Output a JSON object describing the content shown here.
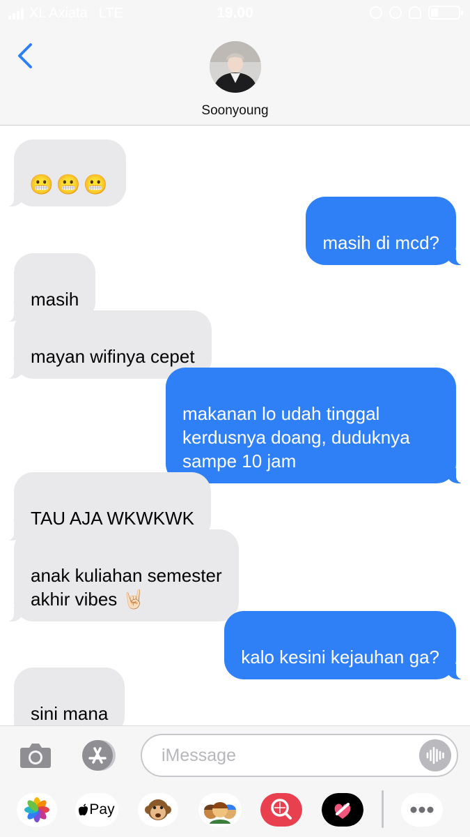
{
  "status_bar": {
    "carrier": "XL Axiata",
    "network": "LTE",
    "time": "19.00"
  },
  "header": {
    "contact_name": "Soonyoung"
  },
  "messages": [
    {
      "direction": "in",
      "text": "😬😬😬"
    },
    {
      "direction": "out",
      "text": "masih di mcd?"
    },
    {
      "direction": "in",
      "text": "masih"
    },
    {
      "direction": "in",
      "text": "mayan wifinya cepet"
    },
    {
      "direction": "out",
      "text": "makanan lo udah tinggal\nkerdusnya doang, duduknya\nsampe 10 jam"
    },
    {
      "direction": "in",
      "text": "TAU AJA WKWKWK"
    },
    {
      "direction": "in",
      "text": "anak kuliahan semester\nakhir vibes 🤘🏻"
    },
    {
      "direction": "out",
      "text": "kalo kesini kejauhan ga?"
    },
    {
      "direction": "in",
      "text": "sini mana"
    }
  ],
  "composer": {
    "placeholder": "iMessage"
  },
  "app_drawer": {
    "apple_pay_label": "Pay"
  },
  "colors": {
    "outgoing_bubble": "#2f80f6",
    "incoming_bubble": "#e9e9eb",
    "back_chevron": "#2f80f6"
  },
  "icons": [
    "back-chevron-icon",
    "camera-icon",
    "app-store-icon",
    "audio-waveform-icon",
    "photos-icon",
    "apple-pay-icon",
    "monkey-emoji-icon",
    "memoji-icon",
    "search-images-icon",
    "digital-touch-icon",
    "more-icon"
  ]
}
